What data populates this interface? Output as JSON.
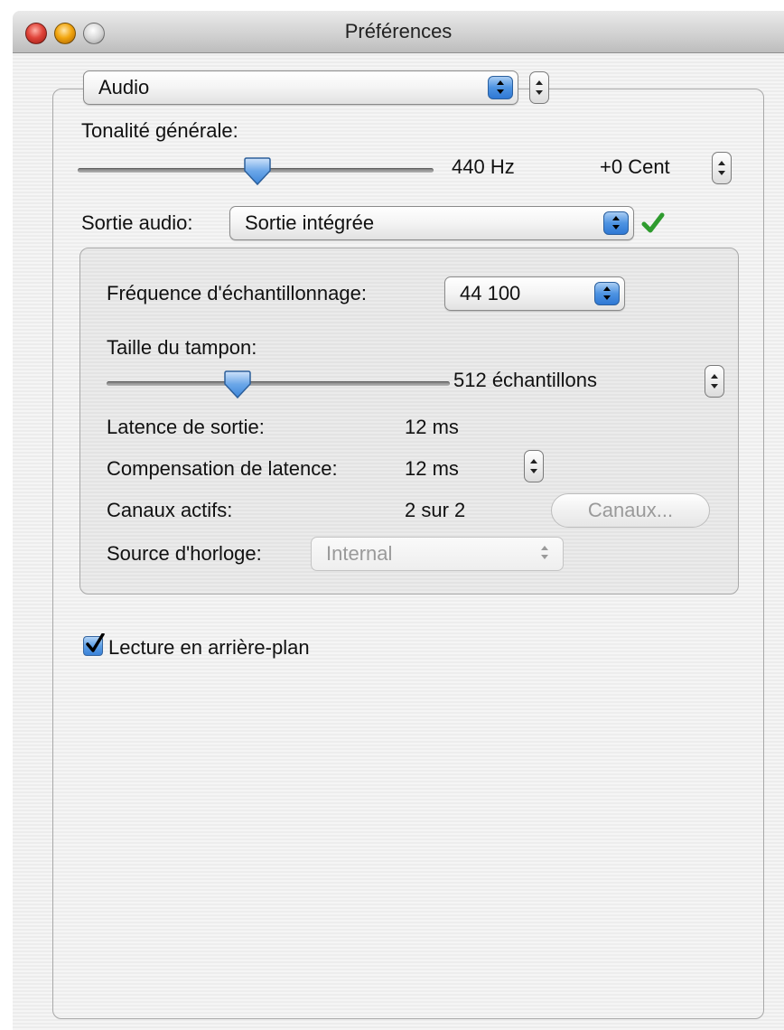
{
  "window": {
    "title": "Préférences"
  },
  "section_popup": {
    "value": "Audio"
  },
  "pitch": {
    "label": "Tonalité générale:",
    "frequency": "440 Hz",
    "cent": "+0 Cent",
    "slider_value": 0.5
  },
  "audio_output": {
    "label": "Sortie audio:",
    "value": "Sortie intégrée",
    "status_icon": "checkmark-icon",
    "status_color": "#2e9b2e"
  },
  "device": {
    "sample_rate_label": "Fréquence d'échantillonnage:",
    "sample_rate_value": "44 100",
    "buffer_label": "Taille du tampon:",
    "buffer_value": "512 échantillons",
    "buffer_slider_value": 0.39,
    "output_latency_label": "Latence de sortie:",
    "output_latency_value": "12 ms",
    "latency_comp_label": "Compensation de latence:",
    "latency_comp_value": "12 ms",
    "active_channels_label": "Canaux actifs:",
    "active_channels_value": "2 sur 2",
    "channels_button": "Canaux...",
    "clock_source_label": "Source d'horloge:",
    "clock_source_value": "Internal"
  },
  "background_playback": {
    "label": "Lecture en arrière-plan",
    "checked": true
  },
  "colors": {
    "accent": "#3a82d8",
    "check_green": "#2e9b2e"
  }
}
